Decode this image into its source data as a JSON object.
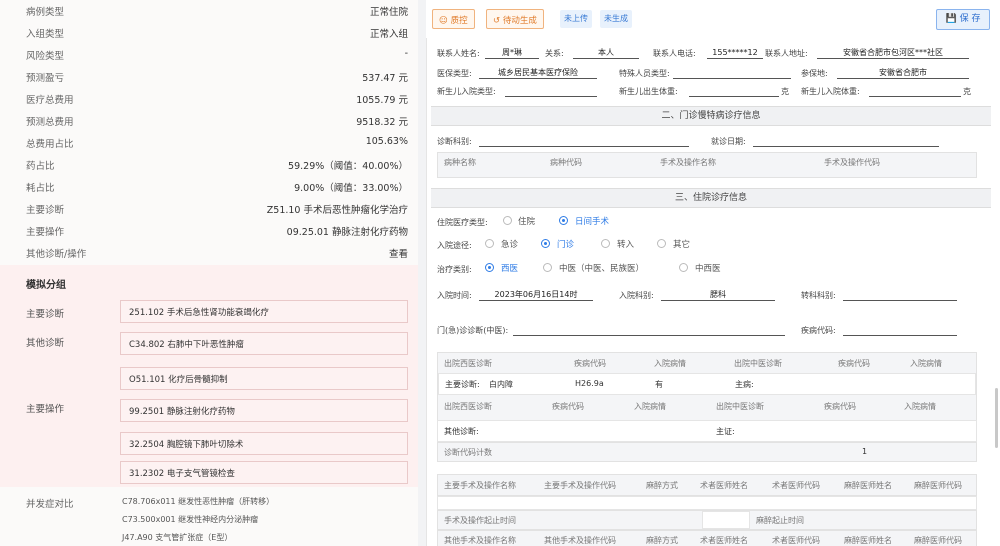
{
  "left": {
    "rows": [
      {
        "k": "病例类型",
        "v": "正常住院"
      },
      {
        "k": "入组类型",
        "v": "正常入组"
      },
      {
        "k": "风险类型",
        "v": "-"
      },
      {
        "k": "预测盈亏",
        "v": "537.47 元"
      },
      {
        "k": "医疗总费用",
        "v": "1055.79 元"
      },
      {
        "k": "预测总费用",
        "v": "9518.32 元"
      },
      {
        "k": "总费用占比",
        "v": "105.63%"
      },
      {
        "k": "药占比",
        "v": "59.29%（阈值：40.00%）"
      },
      {
        "k": "耗占比",
        "v": "9.00%（阈值：33.00%）"
      },
      {
        "k": "主要诊断",
        "v": "Z51.10 手术后恶性肿瘤化学治疗"
      },
      {
        "k": "主要操作",
        "v": "09.25.01 静脉注射化疗药物"
      },
      {
        "k": "其他诊断/操作",
        "v": "查看"
      }
    ],
    "sim": {
      "title": "模拟分组",
      "main_diag_label": "主要诊断",
      "other_diag_label": "其他诊断",
      "main_op_label": "主要操作",
      "main_diag": "251.102 手术后急性肾功能衰竭化疗",
      "other_diag": [
        "C34.802 右肺中下叶恶性肿瘤",
        "O51.101 化疗后骨髓抑制"
      ],
      "main_op": [
        "99.2501 静脉注射化疗药物",
        "32.2504 胸腔镜下肺叶切除术",
        "31.2302 电子支气管镜检查"
      ]
    },
    "comp": {
      "label": "并发症对比",
      "items": [
        "C78.706x011 继发性恶性肿瘤（肝转移）",
        "C73.500x001 继发性神经内分泌肿瘤",
        "J47.A90 支气管扩张症（E型）"
      ]
    }
  },
  "toolbar": {
    "btn_quality": "质控",
    "btn_auto": "待动生成",
    "badge_upload": "未上传",
    "badge_gen": "未生成",
    "save": "保 存"
  },
  "form": {
    "contact_name_label": "联系人姓名:",
    "contact_name": "周*琳",
    "relation_label": "关系:",
    "relation": "本人",
    "contact_phone_label": "联系人电话:",
    "contact_phone": "155*****12",
    "contact_addr_label": "联系人地址:",
    "contact_addr": "安徽省合肥市包河区***社区",
    "insurance_label": "医保类型:",
    "insurance": "城乡居民基本医疗保险",
    "special_label": "特殊人员类型:",
    "insured_place_label": "参保地:",
    "insured_place": "安徽省合肥市",
    "newborn_in_type_label": "新生儿入院类型:",
    "newborn_birth_weight_label": "新生儿出生体重:",
    "newborn_in_weight_label": "新生儿入院体重:",
    "unit_g": "克",
    "sec2": "二、门诊慢特病诊疗信息",
    "diag_dept_label": "诊断科别:",
    "visit_date_label": "就诊日期:",
    "opd_headers": [
      "病种名称",
      "病种代码",
      "手术及操作名称",
      "手术及操作代码"
    ],
    "sec3": "三、住院诊疗信息",
    "care_type_label": "住院医疗类型:",
    "care_types": [
      "住院",
      "日间手术"
    ],
    "admit_route_label": "入院途径:",
    "admit_routes": [
      "急诊",
      "门诊",
      "转入",
      "其它"
    ],
    "treat_type_label": "治疗类别:",
    "treat_types": [
      "西医",
      "中医（中医、民族医）",
      "中西医"
    ],
    "admit_time_label": "入院时间:",
    "admit_time": "2023年06月16日14时",
    "admit_dept_label": "入院科别:",
    "admit_dept": "腮科",
    "transfer_dept_label": "转科科别:",
    "opd_diag_label": "门(急)诊诊断(中医):",
    "disease_code_label": "疾病代码:",
    "diag_headers": [
      "出院西医诊断",
      "疾病代码",
      "入院病情",
      "出院中医诊断",
      "疾病代码",
      "入院病情"
    ],
    "main_diag_label": "主要诊断:",
    "main_diag": "白内障",
    "main_diag_code": "H26.9a",
    "main_diag_cond": "有",
    "main_disease_label": "主病:",
    "other_diag_label": "其他诊断:",
    "main_syndrome_label": "主证:",
    "diag_code_count_label": "诊断代码计数",
    "diag_code_count": "1",
    "op_headers": [
      "主要手术及操作名称",
      "主要手术及操作代码",
      "麻醉方式",
      "术者医师姓名",
      "术者医师代码",
      "麻醉医师姓名",
      "麻醉医师代码"
    ],
    "op_time_label": "手术及操作起止时间",
    "anes_time_label": "麻醉起止时间",
    "other_op_headers": [
      "其他手术及操作名称",
      "其他手术及操作代码",
      "麻醉方式",
      "术者医师姓名",
      "术者医师代码",
      "麻醉医师姓名",
      "麻醉医师代码"
    ]
  }
}
